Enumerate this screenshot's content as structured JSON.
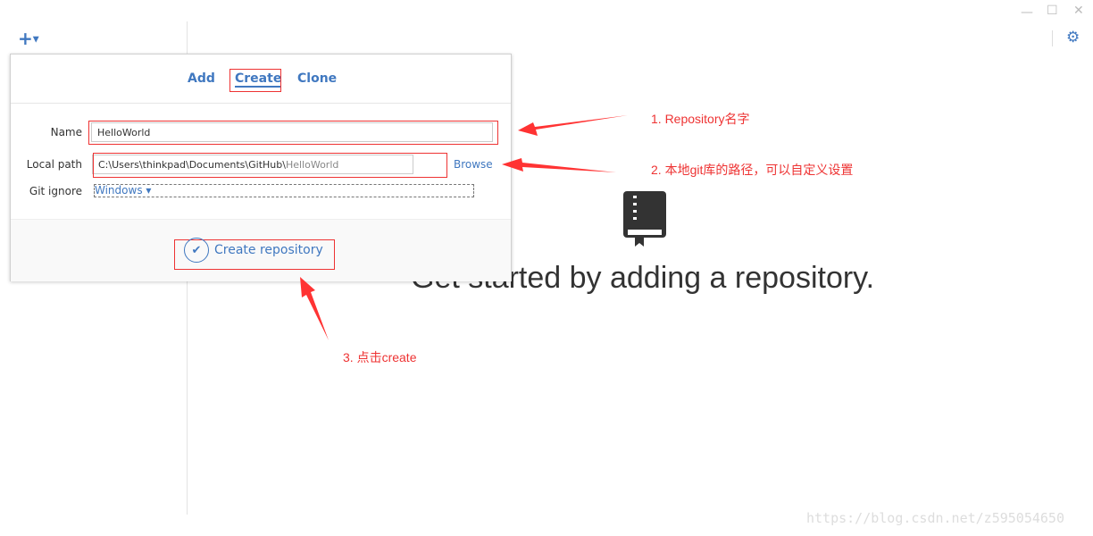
{
  "window": {
    "minimize": "—",
    "maximize": "☐",
    "close": "✕"
  },
  "toolbar": {
    "add_icon": "plus-icon",
    "settings_icon": "gear-icon"
  },
  "popup": {
    "tabs": [
      {
        "label": "Add"
      },
      {
        "label": "Create",
        "active": true
      },
      {
        "label": "Clone"
      }
    ],
    "name_label": "Name",
    "name_value": "HelloWorld",
    "path_label": "Local path",
    "path_prefix": "C:\\Users\\thinkpad\\Documents\\GitHub\\",
    "path_suffix": "HelloWorld",
    "browse": "Browse",
    "gitignore_label": "Git ignore",
    "gitignore_value": "Windows ▾",
    "create_button": "Create repository"
  },
  "main": {
    "empty_message": "Get started by adding a repository."
  },
  "annotations": [
    "1. Repository名字",
    "2. 本地git库的路径，可以自定义设置",
    "3. 点击create"
  ],
  "watermark": "https://blog.csdn.net/z595054650",
  "colors": {
    "accent": "#4078c0",
    "annotation": "#ee3333"
  }
}
